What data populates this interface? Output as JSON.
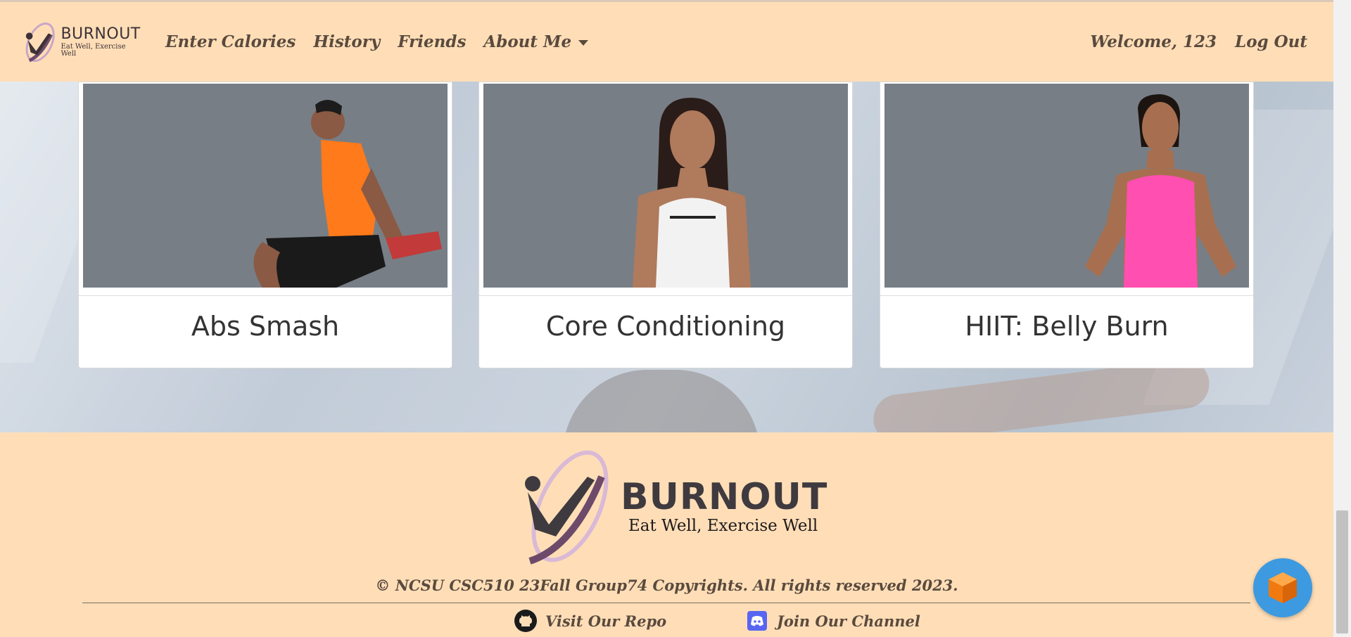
{
  "navbar": {
    "brand_name": "BURNOUT",
    "brand_tagline": "Eat Well, Exercise Well",
    "links": [
      "Enter Calories",
      "History",
      "Friends",
      "About Me"
    ],
    "welcome": "Welcome, 123",
    "logout": "Log Out"
  },
  "cards": [
    {
      "title": "Abs Smash"
    },
    {
      "title": "Core Conditioning"
    },
    {
      "title": "HIIT: Belly Burn"
    }
  ],
  "footer": {
    "brand_name": "BURNOUT",
    "brand_tagline": "Eat Well, Exercise Well",
    "copyright": "© NCSU CSC510 23Fall Group74 Copyrights. All rights reserved 2023.",
    "repo_link": "Visit Our Repo",
    "channel_link": "Join Our Channel"
  },
  "colors": {
    "background": "#ffdeb7",
    "nav_text": "#5a4a3e",
    "chat_bubble": "#3d9ae0",
    "card_image_bg": "#787e85"
  }
}
